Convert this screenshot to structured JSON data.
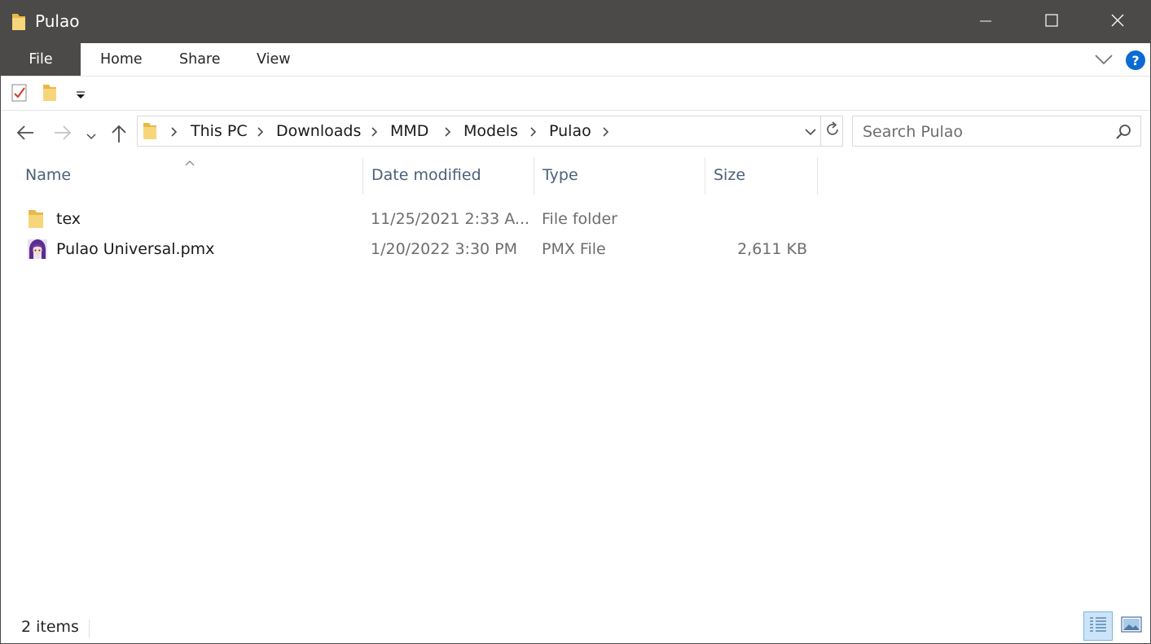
{
  "window": {
    "title": "Pulao"
  },
  "ribbon": {
    "tabs": [
      {
        "label": "File"
      },
      {
        "label": "Home"
      },
      {
        "label": "Share"
      },
      {
        "label": "View"
      }
    ],
    "help_label": "?"
  },
  "address": {
    "crumbs": [
      "This PC",
      "Downloads",
      "MMD",
      "Models",
      "Pulao"
    ]
  },
  "search": {
    "placeholder": "Search Pulao"
  },
  "columns": {
    "name": "Name",
    "date": "Date modified",
    "type": "Type",
    "size": "Size"
  },
  "files": [
    {
      "name": "tex",
      "date": "11/25/2021 2:33 A...",
      "type": "File folder",
      "size": "",
      "icon": "folder-icon"
    },
    {
      "name": "Pulao Universal.pmx",
      "date": "1/20/2022 3:30 PM",
      "type": "PMX File",
      "size": "2,611 KB",
      "icon": "pmx-file-icon"
    }
  ],
  "status": {
    "count": "2 items"
  },
  "colors": {
    "titlebar": "#4b4a48",
    "header_text": "#4c607a",
    "accent": "#0b6bd3",
    "selected_view": "#cce4f7"
  }
}
